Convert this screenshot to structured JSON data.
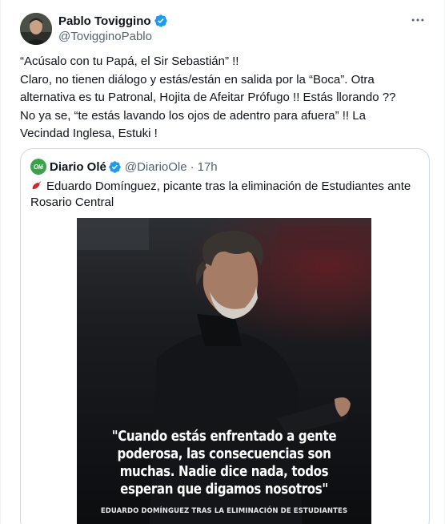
{
  "author": {
    "name": "Pablo Toviggino",
    "handle": "@TovigginoPablo"
  },
  "tweet": {
    "lines": [
      "“Acúsalo con tu Papá, el Sir Sebastián” !!",
      "Claro, no tienen diálogo y estás/están en salida por la “Boca”. Otra",
      "alternativa es tu Patronal, Hojita de Afeitar Prófugo !! Estás llorando ??",
      "No ya se, “te estás lavando los ojos de adentro para afuera” !! La",
      "Vecindad Inglesa, Estuki !"
    ]
  },
  "quote": {
    "name": "Diario Olé",
    "handle": "@DiarioOle",
    "dot": "·",
    "time": "17h",
    "avatar_text": "Olé",
    "lines": [
      "Eduardo Domínguez, picante tras la eliminación de Estudiantes ante",
      "Rosario Central"
    ],
    "image": {
      "caption_lines": [
        "\"Cuando estás enfrentado a gente",
        "poderosa, las consecuencias son",
        "muchas. Nadie dice nada, todos",
        "esperan que digamos nosotros\""
      ],
      "credit": "EDUARDO DOMÍNGUEZ TRAS LA ELIMINACIÓN DE ESTUDIANTES"
    }
  },
  "icons": {
    "verified": "verified-badge-icon",
    "more": "more-options-icon",
    "pepper": "hot-pepper-emoji-icon"
  },
  "colors": {
    "verified": "#1d9bf0",
    "text": "#0f1419",
    "secondary": "#536471",
    "border": "#cfd9de",
    "ole_green": "#3aa34a"
  }
}
